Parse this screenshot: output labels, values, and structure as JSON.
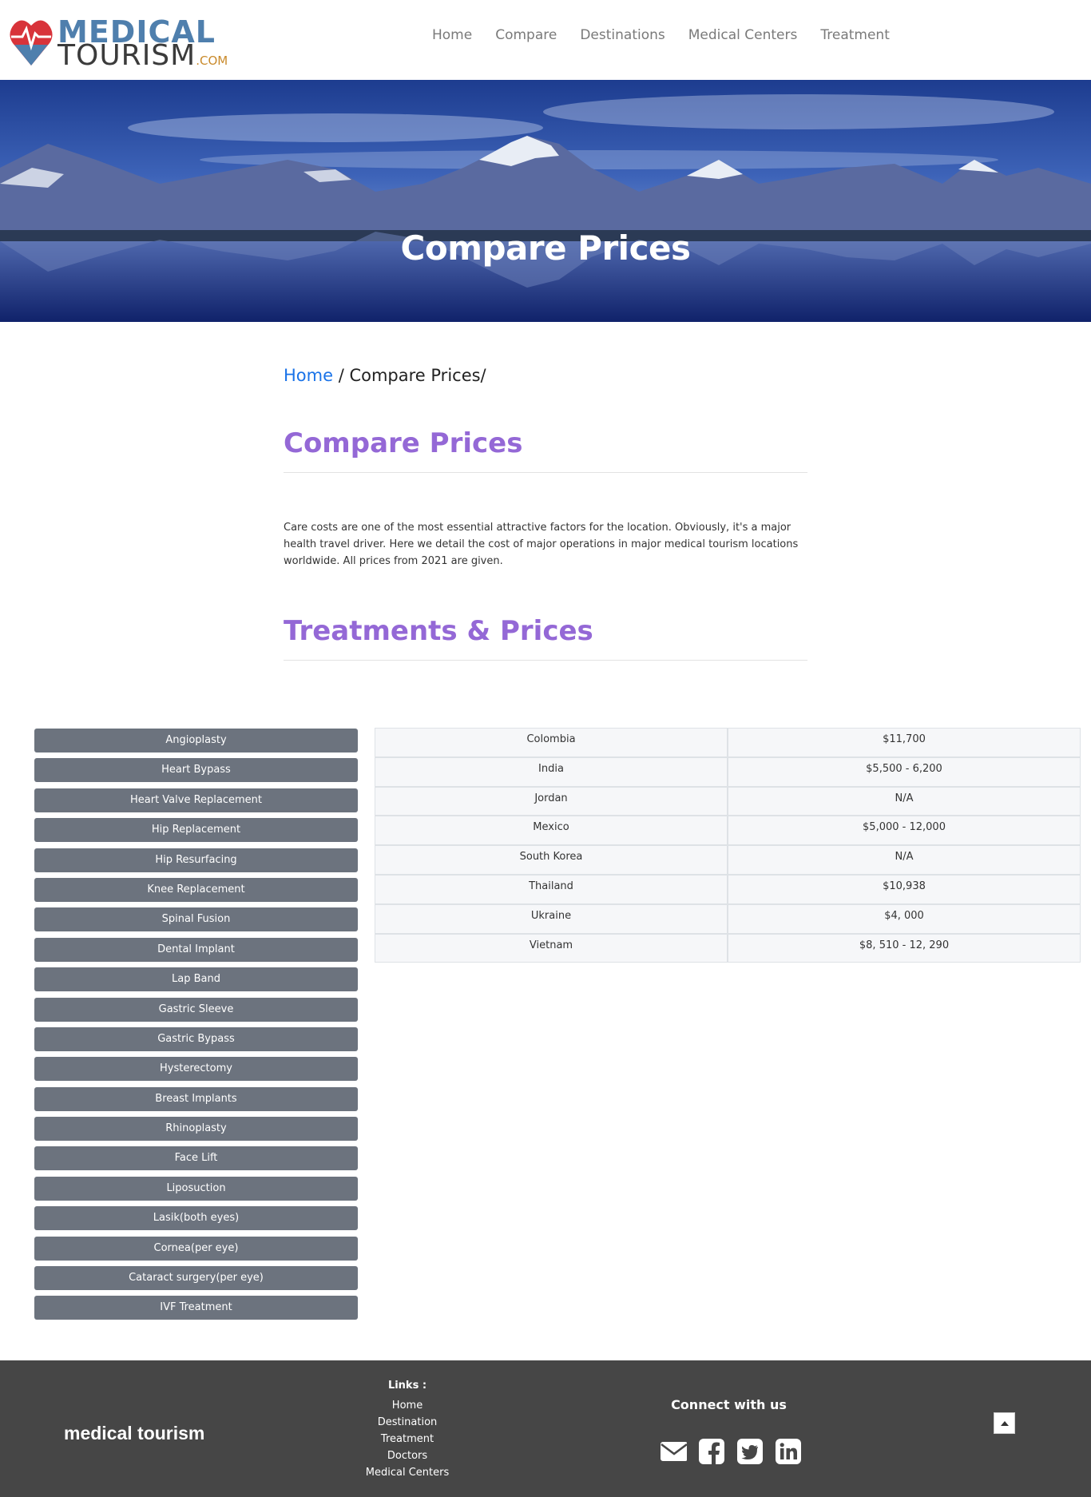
{
  "brand": {
    "line1": "MEDICAL",
    "line2": "TOURISM",
    "suffix": ".COM"
  },
  "nav": [
    "Home",
    "Compare",
    "Destinations",
    "Medical Centers",
    "Treatment"
  ],
  "hero": {
    "title": "Compare Prices"
  },
  "breadcrumb": {
    "home": "Home",
    "current": "/ Compare Prices/"
  },
  "section1": {
    "title": "Compare Prices"
  },
  "intro": "Care costs are one of the most essential attractive factors for the location. Obviously, it's a major health travel driver. Here we detail the cost of major operations in major medical tourism locations worldwide. All prices from 2021 are given.",
  "section2": {
    "title": "Treatments & Prices"
  },
  "treatments": [
    "Angioplasty",
    "Heart Bypass",
    "Heart Valve Replacement",
    "Hip Replacement",
    "Hip Resurfacing",
    "Knee Replacement",
    "Spinal Fusion",
    "Dental Implant",
    "Lap Band",
    "Gastric Sleeve",
    "Gastric Bypass",
    "Hysterectomy",
    "Breast Implants",
    "Rhinoplasty",
    "Face Lift",
    "Liposuction",
    "Lasik(both eyes)",
    "Cornea(per eye)",
    "Cataract surgery(per eye)",
    "IVF Treatment"
  ],
  "prices": [
    {
      "country": "Colombia",
      "price": "$11,700"
    },
    {
      "country": "India",
      "price": "$5,500 - 6,200"
    },
    {
      "country": "Jordan",
      "price": "N/A"
    },
    {
      "country": "Mexico",
      "price": "$5,000 - 12,000"
    },
    {
      "country": "South Korea",
      "price": "N/A"
    },
    {
      "country": "Thailand",
      "price": "$10,938"
    },
    {
      "country": "Ukraine",
      "price": "$4, 000"
    },
    {
      "country": "Vietnam",
      "price": "$8, 510 - 12, 290"
    }
  ],
  "footer": {
    "brand": "medical tourism",
    "links_heading": "Links :",
    "links": [
      "Home",
      "Destination",
      "Treatment",
      "Doctors",
      "Medical Centers"
    ],
    "connect": "Connect with us",
    "socials": [
      "envelope-icon",
      "facebook-icon",
      "twitter-icon",
      "linkedin-icon"
    ]
  },
  "colors": {
    "accent": "#9468d6",
    "link": "#1a73e8",
    "button": "#6c737e",
    "footer": "#464646"
  }
}
